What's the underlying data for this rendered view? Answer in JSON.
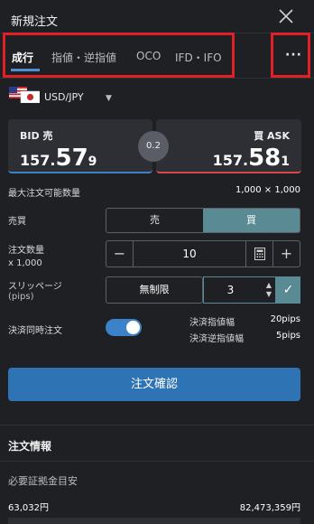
{
  "header": {
    "title": "新規注文"
  },
  "tabs": [
    {
      "label": "成行",
      "active": true
    },
    {
      "label": "指値・逆指値"
    },
    {
      "label": "OCO"
    },
    {
      "label": "IFD・IFO"
    }
  ],
  "more_label": "···",
  "pair": {
    "label": "USD/JPY",
    "caret": "▼"
  },
  "bid": {
    "label": "BID 売",
    "price_head": "157.",
    "price_big": "57",
    "price_tail": "9"
  },
  "ask": {
    "label": "買 ASK",
    "price_head": "157.",
    "price_big": "58",
    "price_tail": "1"
  },
  "spread": "0.2",
  "max_qty": {
    "label": "最大注文可能数量",
    "value": "1,000 × 1,000"
  },
  "side": {
    "label": "売買",
    "sell": "売",
    "buy": "買",
    "selected": "buy"
  },
  "quantity": {
    "label": "注文数量",
    "sublabel": "x 1,000",
    "value": "10",
    "minus": "−",
    "plus": "+"
  },
  "slippage": {
    "label": "スリッページ",
    "sublabel": "(pips)",
    "unlimited": "無制限",
    "value": "3",
    "ok": "✓"
  },
  "settle": {
    "label": "決済同時注文",
    "enabled": true,
    "limit_label": "決済指値幅",
    "limit_value": "20pips",
    "stop_label": "決済逆指値幅",
    "stop_value": "5pips"
  },
  "confirm_label": "注文確認",
  "order_info": {
    "title": "注文情報",
    "margin_label": "必要証拠金目安",
    "margin_left": "63,032円",
    "margin_right": "82,473,359円"
  },
  "colors": {
    "accent": "#2e74b5",
    "buy": "#5a8a94",
    "bid_line": "#3b82c9",
    "ask_line": "#d9484c",
    "highlight": "#e01f26"
  }
}
